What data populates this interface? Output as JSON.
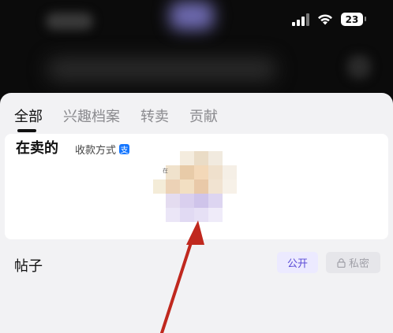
{
  "status_bar": {
    "battery": "23"
  },
  "tabs": [
    {
      "label": "全部",
      "active": true
    },
    {
      "label": "兴趣档案",
      "active": false
    },
    {
      "label": "转卖",
      "active": false
    },
    {
      "label": "贡献",
      "active": false
    }
  ],
  "selling": {
    "title": "在卖的",
    "payment_label": "收款方式",
    "alipay_glyph": "支",
    "item_label": "在"
  },
  "posts": {
    "title": "帖子",
    "public_label": "公开",
    "private_label": "私密"
  },
  "colors": {
    "accent": "#5a4bd6",
    "annotation_arrow": "#c0281e"
  }
}
